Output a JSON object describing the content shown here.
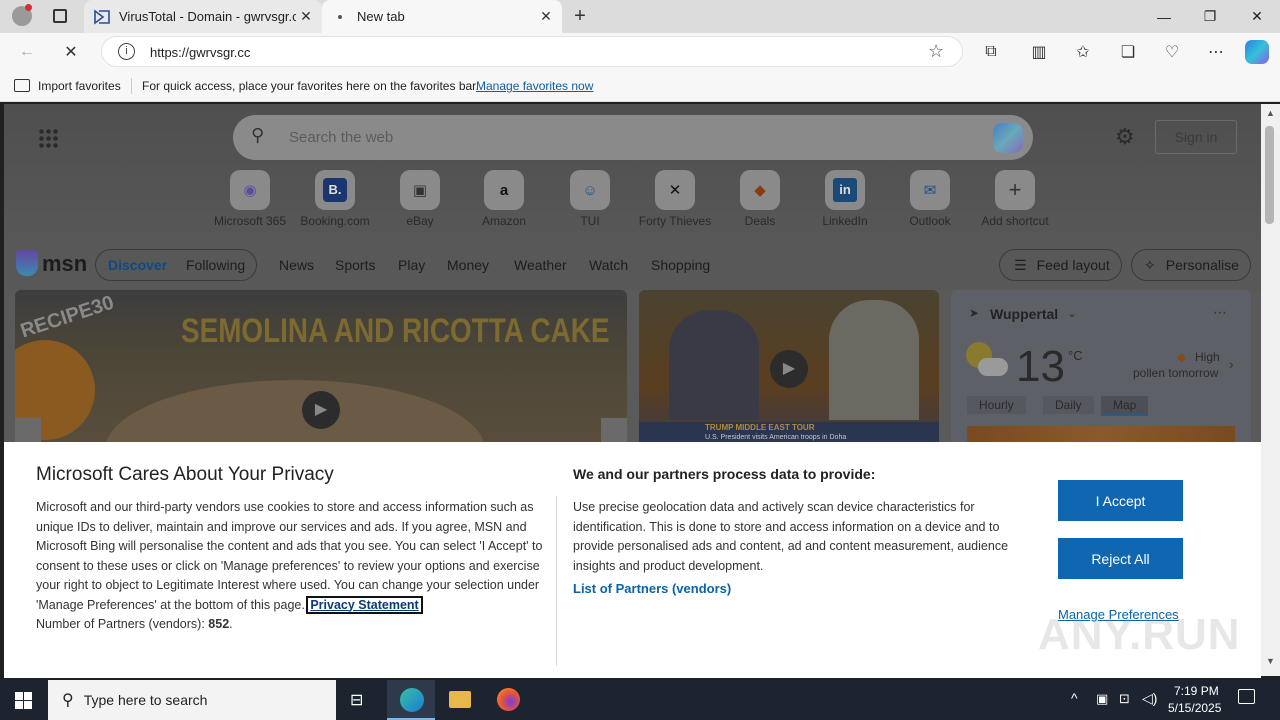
{
  "tabs": [
    {
      "title": "VirusTotal - Domain - gwrvsgr.cc"
    },
    {
      "title": "New tab"
    }
  ],
  "address": {
    "url": "https://gwrvsgr.cc"
  },
  "favorites_bar": {
    "import_label": "Import favorites",
    "message": "For quick access, place your favorites here on the favorites bar.",
    "manage_link": "Manage favorites now"
  },
  "newtab": {
    "search_placeholder": "Search the web",
    "sign_in": "Sign in",
    "shortcuts": [
      "Microsoft 365",
      "Booking.com",
      "eBay",
      "Amazon",
      "TUI",
      "Forty Thieves",
      "Deals",
      "LinkedIn",
      "Outlook",
      "Add shortcut"
    ],
    "msn_logo": "msn",
    "nav": [
      "Discover",
      "Following",
      "News",
      "Sports",
      "Play",
      "Money",
      "Weather",
      "Watch",
      "Shopping"
    ],
    "feed_layout": "Feed layout",
    "personalise": "Personalise",
    "hero_title": "SEMOLINA AND RICOTTA CAKE",
    "hero_badge": "RECIPE30",
    "news_banner": "TRUMP MIDDLE EAST TOUR",
    "news_subbanner": "U.S. President visits American troops in Doha",
    "weather": {
      "location": "Wuppertal",
      "temp": "13",
      "unit": "°C",
      "pollen_level": "High",
      "pollen_text": "pollen tomorrow",
      "tabs": [
        "Hourly",
        "Daily",
        "Map"
      ]
    }
  },
  "consent": {
    "title": "Microsoft Cares About Your Privacy",
    "body": "Microsoft and our third-party vendors use cookies to store and access information such as unique IDs to deliver, maintain and improve our services and ads. If you agree, MSN and Microsoft Bing will personalise the content and ads that you see. You can select 'I Accept' to consent to these uses or click on 'Manage preferences' to review your options and exercise your right to object to Legitimate Interest where used.  You can change your selection under 'Manage Preferences' at the bottom of this page.",
    "privacy_link": "Privacy Statement",
    "partners_label": "Number of Partners (vendors):",
    "partners_count": "852",
    "col2_title": "We and our partners process data to provide:",
    "col2_body": "Use precise geolocation data and actively scan device characteristics for identification. This is done to store and access information on a device and to provide personalised ads and content, ad and content measurement, audience insights and product development.",
    "partners_list_link": "List of Partners (vendors)",
    "accept": "I Accept",
    "reject": "Reject All",
    "manage": "Manage Preferences"
  },
  "watermark": "ANY.RUN",
  "taskbar": {
    "search_placeholder": "Type here to search",
    "time": "7:19 PM",
    "date": "5/15/2025"
  }
}
